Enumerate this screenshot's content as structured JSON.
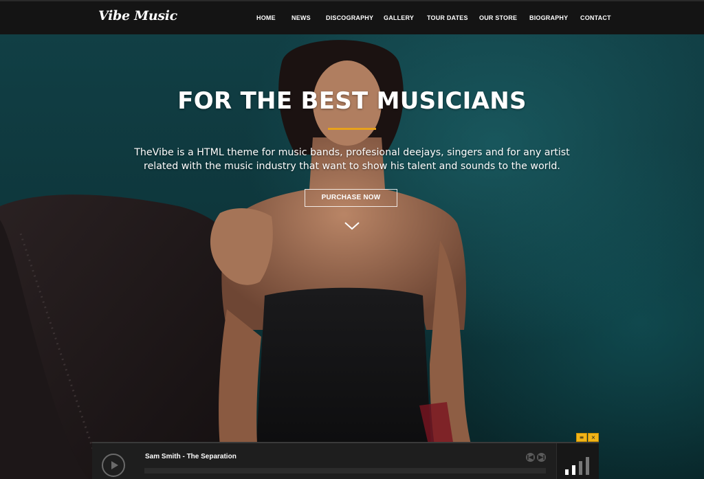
{
  "brand": {
    "logo": "Vibe Music"
  },
  "nav": {
    "items": [
      {
        "label": "HOME"
      },
      {
        "label": "NEWS"
      },
      {
        "label": "DISCOGRAPHY"
      },
      {
        "label": "GALLERY"
      },
      {
        "label": "TOUR DATES"
      },
      {
        "label": "OUR STORE"
      },
      {
        "label": "BIOGRAPHY"
      },
      {
        "label": "CONTACT"
      }
    ]
  },
  "hero": {
    "title": "FOR THE BEST MUSICIANS",
    "description": "TheVibe is a HTML theme for music bands, profesional deejays, singers and for any artist related with the music industry that want to show his talent and sounds to the world.",
    "cta_label": "PURCHASE NOW",
    "scroll_icon": "chevron-down-icon"
  },
  "player": {
    "track": "Sam Smith - The Separation",
    "progress": 0.0,
    "volume_level": 2,
    "volume_bars": 4,
    "tab_icons": [
      "menu-icon",
      "close-icon"
    ],
    "tab_glyphs": [
      "≡",
      "×"
    ],
    "controls": [
      "previous-icon",
      "next-icon"
    ]
  },
  "colors": {
    "accent": "#e8a11a",
    "player_tab": "#f2b417",
    "header_bg": "#141414",
    "player_bg": "#1e1e1e"
  }
}
